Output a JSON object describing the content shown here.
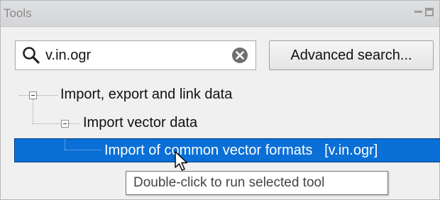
{
  "panel": {
    "title": "Tools"
  },
  "search": {
    "value": "v.in.ogr",
    "placeholder": ""
  },
  "buttons": {
    "advanced_search": "Advanced search..."
  },
  "tree": {
    "nodes": [
      {
        "label": "Import, export and link data",
        "level": 0,
        "expanded": true
      },
      {
        "label": "Import vector data",
        "level": 1,
        "expanded": true
      },
      {
        "label": "Import of common vector formats   [v.in.ogr]",
        "level": 2,
        "selected": true
      }
    ]
  },
  "tooltip": {
    "text": "Double-click to run selected tool"
  },
  "colors": {
    "selection": "#0a6fd6",
    "selection_border": "#003e86",
    "background": "#f0f0f0"
  },
  "icons": {
    "search": "search-icon",
    "clear": "clear-icon",
    "minimize": "minimize-icon",
    "float": "float-icon",
    "cursor": "mouse-cursor-icon"
  }
}
